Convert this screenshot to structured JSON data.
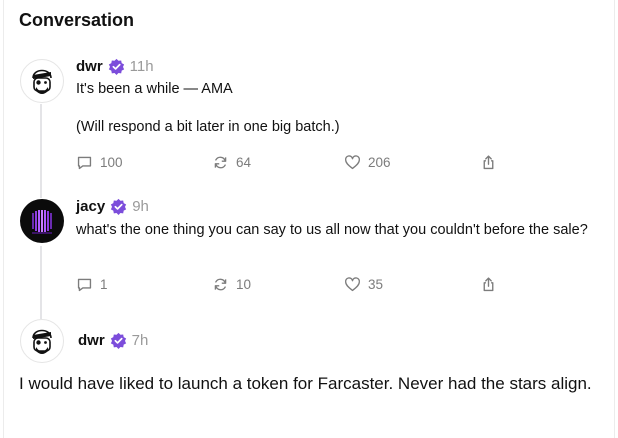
{
  "header": {
    "title": "Conversation"
  },
  "posts": [
    {
      "author": "dwr",
      "time": "11h",
      "avatar_icon": "pirate-face-avatar",
      "lines": [
        "It's been a while — AMA",
        "(Will respond a bit later in one big batch.)"
      ],
      "replies": "100",
      "recasts": "64",
      "likes": "206"
    },
    {
      "author": "jacy",
      "time": "9h",
      "avatar_icon": "purple-glow-avatar",
      "lines": [
        "what's the one thing you can say to us all now that you couldn't before the sale?"
      ],
      "replies": "1",
      "recasts": "10",
      "likes": "35"
    },
    {
      "author": "dwr",
      "time": "7h",
      "avatar_icon": "pirate-face-avatar",
      "text": "I would have liked to launch a token for Farcaster. Never had the stars align."
    }
  ],
  "colors": {
    "verified_badge": "#7c4ddb",
    "thread_line": "#e4e4e7",
    "muted_text": "#7c7c7c"
  },
  "icons": [
    "reply-icon",
    "recast-icon",
    "like-icon",
    "share-icon",
    "verified-badge-icon"
  ]
}
